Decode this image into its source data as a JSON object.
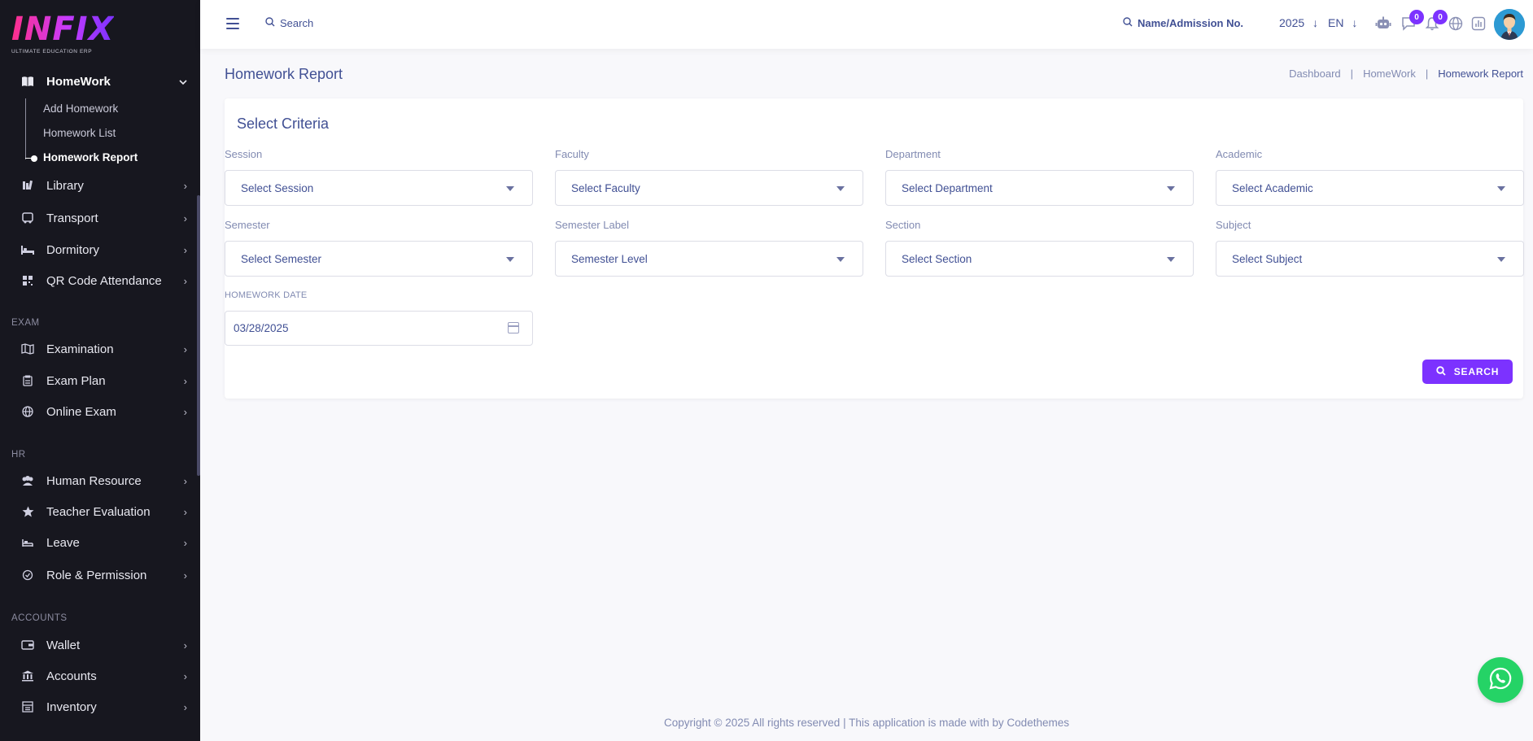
{
  "app": {
    "logo_text": "INFIX",
    "logo_subtitle": "ULTIMATE EDUCATION ERP"
  },
  "sidebar": {
    "homework": {
      "label": "HomeWork",
      "icon": "book-icon",
      "subitems": [
        {
          "label": "Add Homework"
        },
        {
          "label": "Homework List"
        },
        {
          "label": "Homework Report",
          "active": true
        }
      ]
    },
    "items_top": [
      {
        "label": "Library",
        "icon": "library-icon"
      },
      {
        "label": "Transport",
        "icon": "bus-icon"
      },
      {
        "label": "Dormitory",
        "icon": "bed-icon"
      },
      {
        "label": "QR Code Attendance",
        "icon": "qr-code-icon"
      }
    ],
    "sections": [
      {
        "title": "EXAM",
        "items": [
          {
            "label": "Examination",
            "icon": "map-icon"
          },
          {
            "label": "Exam Plan",
            "icon": "clipboard-icon"
          },
          {
            "label": "Online Exam",
            "icon": "globe-icon"
          }
        ]
      },
      {
        "title": "HR",
        "items": [
          {
            "label": "Human Resource",
            "icon": "users-icon"
          },
          {
            "label": "Teacher Evaluation",
            "icon": "star-icon"
          },
          {
            "label": "Leave",
            "icon": "sofa-icon"
          },
          {
            "label": "Role & Permission",
            "icon": "shield-icon"
          }
        ]
      },
      {
        "title": "ACCOUNTS",
        "items": [
          {
            "label": "Wallet",
            "icon": "wallet-icon"
          },
          {
            "label": "Accounts",
            "icon": "bank-icon"
          },
          {
            "label": "Inventory",
            "icon": "inventory-icon"
          }
        ]
      }
    ]
  },
  "header": {
    "search_label": "Search",
    "student_search_label": "Name/Admission No.",
    "year": "2025",
    "language": "EN",
    "chat_count": "0",
    "notification_count": "0"
  },
  "page": {
    "title": "Homework Report",
    "breadcrumb": [
      "Dashboard",
      "HomeWork",
      "Homework Report"
    ]
  },
  "criteria": {
    "title": "Select Criteria",
    "fields": [
      {
        "label": "Session",
        "placeholder": "Select Session"
      },
      {
        "label": "Faculty",
        "placeholder": "Select Faculty"
      },
      {
        "label": "Department",
        "placeholder": "Select Department"
      },
      {
        "label": "Academic",
        "placeholder": "Select Academic"
      },
      {
        "label": "Semester",
        "placeholder": "Select Semester"
      },
      {
        "label": "Semester Label",
        "placeholder": "Semester Level"
      },
      {
        "label": "Section",
        "placeholder": "Select Section"
      },
      {
        "label": "Subject",
        "placeholder": "Select Subject"
      }
    ],
    "date_label": "HOMEWORK DATE",
    "date_value": "03/28/2025",
    "search_button": "SEARCH"
  },
  "footer": {
    "text": "Copyright © 2025 All rights reserved | This application is made with by Codethemes"
  },
  "colors": {
    "sidebar_bg": "#17171f",
    "primary": "#7c32ff",
    "text": "#415094",
    "whatsapp": "#25d366"
  }
}
